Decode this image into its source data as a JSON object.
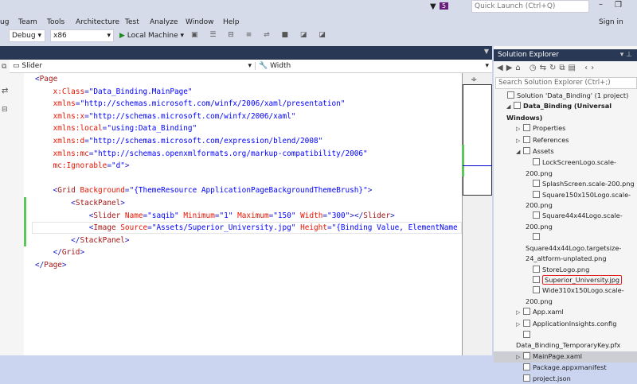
{
  "menu": [
    "ug",
    "Team",
    "Tools",
    "Architecture",
    "Test",
    "Analyze",
    "Window",
    "Help"
  ],
  "toolbar": {
    "config": "Debug",
    "platform": "x86",
    "run": "Local Machine"
  },
  "titlebar": {
    "notifications": "5",
    "quick_launch": "Quick Launch (Ctrl+Q)",
    "sign_in": "Sign in"
  },
  "nav": {
    "element": "Slider",
    "member": "Width"
  },
  "code": [
    "<Page",
    "    x:Class=\"Data_Binding.MainPage\"",
    "    xmlns=\"http://schemas.microsoft.com/winfx/2006/xaml/presentation\"",
    "    xmlns:x=\"http://schemas.microsoft.com/winfx/2006/xaml\"",
    "    xmlns:local=\"using:Data_Binding\"",
    "    xmlns:d=\"http://schemas.microsoft.com/expression/blend/2008\"",
    "    xmlns:mc=\"http://schemas.openxmlformats.org/markup-compatibility/2006\"",
    "    mc:Ignorable=\"d\">",
    "",
    "    <Grid Background=\"{ThemeResource ApplicationPageBackgroundThemeBrush}\">",
    "        <StackPanel>",
    "            <Slider Name=\"saqib\" Minimum=\"1\" Maximum=\"150\" Width=\"300\"></Slider>",
    "            <Image Source=\"Assets/Superior_University.jpg\" Height=\"{Binding Value, ElementName",
    "        </StackPanel>",
    "    </Grid>",
    "</Page>"
  ],
  "solution_explorer": {
    "title": "Solution Explorer",
    "search": "Search Solution Explorer (Ctrl+;)",
    "items": [
      {
        "label": "Solution 'Data_Binding' (1 project)",
        "level": 0
      },
      {
        "label": "Data_Binding (Universal Windows)",
        "level": 1,
        "bold": true
      },
      {
        "label": "Properties",
        "level": 2
      },
      {
        "label": "References",
        "level": 2
      },
      {
        "label": "Assets",
        "level": 2
      },
      {
        "label": "LockScreenLogo.scale-200.png",
        "level": 3
      },
      {
        "label": "SplashScreen.scale-200.png",
        "level": 3
      },
      {
        "label": "Square150x150Logo.scale-200.png",
        "level": 3
      },
      {
        "label": "Square44x44Logo.scale-200.png",
        "level": 3
      },
      {
        "label": "Square44x44Logo.targetsize-24_altform-unplated.png",
        "level": 3
      },
      {
        "label": "StoreLogo.png",
        "level": 3
      },
      {
        "label": "Superior_University.jpg",
        "level": 3,
        "highlight": true
      },
      {
        "label": "Wide310x150Logo.scale-200.png",
        "level": 3
      },
      {
        "label": "App.xaml",
        "level": 2
      },
      {
        "label": "ApplicationInsights.config",
        "level": 2
      },
      {
        "label": "Data_Binding_TemporaryKey.pfx",
        "level": 2
      },
      {
        "label": "MainPage.xaml",
        "level": 2,
        "selected": true
      },
      {
        "label": "Package.appxmanifest",
        "level": 2
      },
      {
        "label": "project.json",
        "level": 2
      }
    ]
  }
}
